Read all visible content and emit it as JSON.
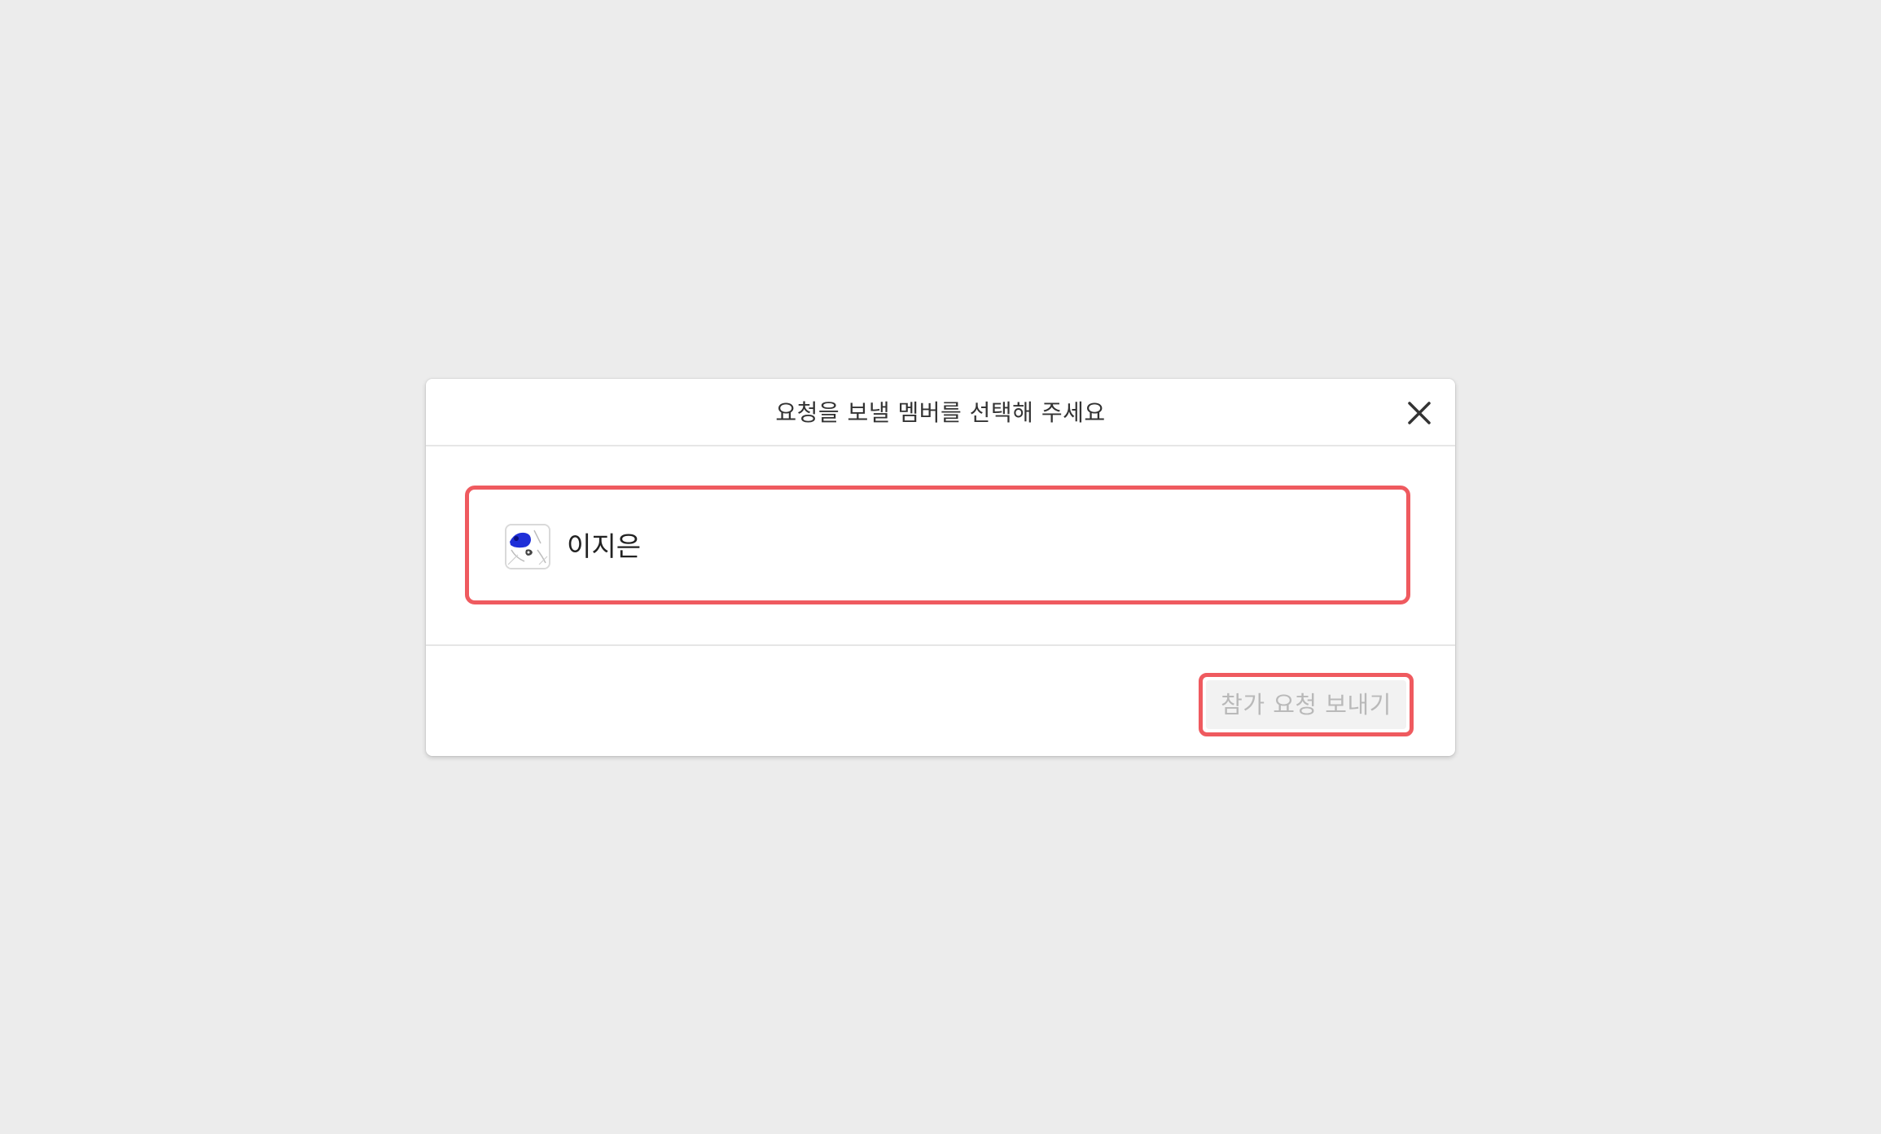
{
  "dialog": {
    "title": "요청을 보낼 멤버를 선택해 주세요",
    "close_icon": "close-icon"
  },
  "members": [
    {
      "name": "이지은",
      "avatar_icon": "avatar-image",
      "selected_highlight": true
    }
  ],
  "footer": {
    "send_button_label": "참가 요청 보내기",
    "send_button_state": "disabled"
  },
  "colors": {
    "background": "#ececec",
    "highlight": "#ef5a5f",
    "disabled_text": "#b9b9b9",
    "avatar_blue": "#1f2fd8"
  }
}
